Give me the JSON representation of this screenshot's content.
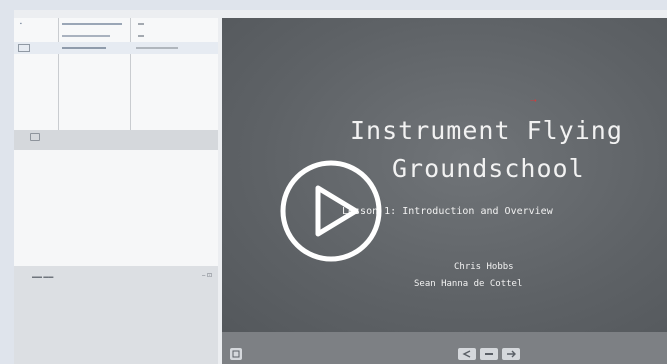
{
  "slide": {
    "title_line1": "Instrument Flying",
    "title_line2": "Groundschool",
    "subtitle": "Lesson 1: Introduction and Overview",
    "author": "Chris Hobbs",
    "affiliation": "Sean Hanna de Cottel",
    "marker": "~•"
  },
  "colors": {
    "slide_bg": "#5e6266",
    "panel_bg": "#f4f5f6",
    "controls_bg": "#7d8084",
    "accent_red": "#d23c3c"
  },
  "icons": [
    "play-icon",
    "slide-icon",
    "prev-icon",
    "pause-icon",
    "next-icon",
    "document-icon"
  ]
}
